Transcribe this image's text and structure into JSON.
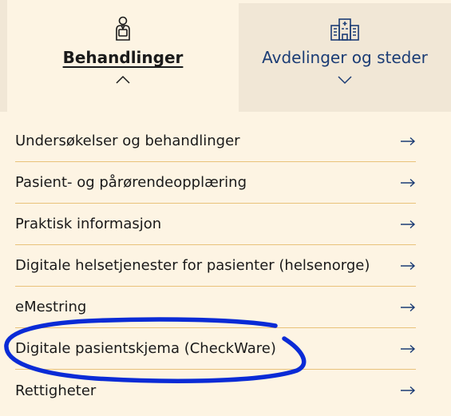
{
  "tabs": [
    {
      "label": "Behandlinger",
      "icon": "doctor-icon",
      "state": "expanded"
    },
    {
      "label": "Avdelinger og steder",
      "icon": "hospital-icon",
      "state": "collapsed"
    }
  ],
  "menu": {
    "items": [
      {
        "label": "Undersøkelser og behandlinger"
      },
      {
        "label": "Pasient- og pårørendeopplæring"
      },
      {
        "label": "Praktisk informasjon"
      },
      {
        "label": "Digitale helsetjenester for pasienter (helsenorge)"
      },
      {
        "label": "eMestring"
      },
      {
        "label": "Digitale pasientskjema (CheckWare)"
      },
      {
        "label": "Rettigheter"
      }
    ],
    "arrow_icon": "arrow-right-icon"
  },
  "colors": {
    "background": "#fdf4e3",
    "inactive_tab": "#f1e7d6",
    "divider": "#e9c27a",
    "link_blue": "#1b3c75",
    "annotation_blue": "#0a2bd6"
  }
}
